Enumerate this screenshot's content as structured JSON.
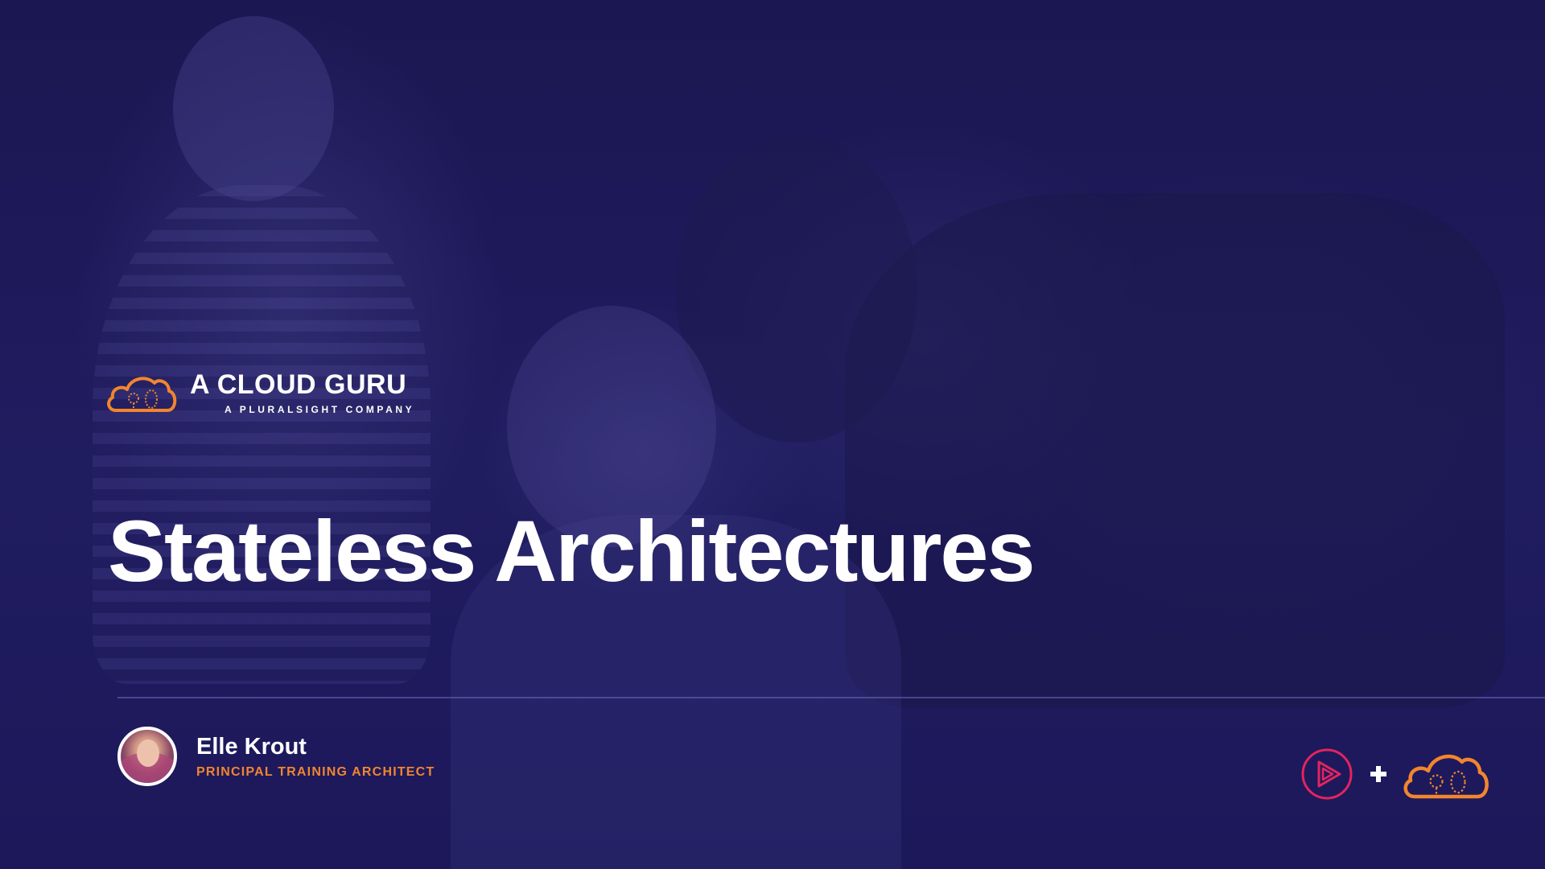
{
  "logo": {
    "name": "A CLOUD GURU",
    "subtitle": "A PLURALSIGHT COMPANY",
    "icon": "cloud-guru-icon"
  },
  "slide": {
    "title": "Stateless Architectures"
  },
  "presenter": {
    "name": "Elle Krout",
    "role": "PRINCIPAL TRAINING ARCHITECT"
  },
  "footer_brands": {
    "left_icon": "pluralsight-play-icon",
    "separator_icon": "plus-icon",
    "right_icon": "cloud-guru-icon"
  },
  "colors": {
    "background": "#1c1856",
    "accent_orange": "#f2852e",
    "pluralsight_pink": "#e3245f",
    "text": "#ffffff"
  }
}
